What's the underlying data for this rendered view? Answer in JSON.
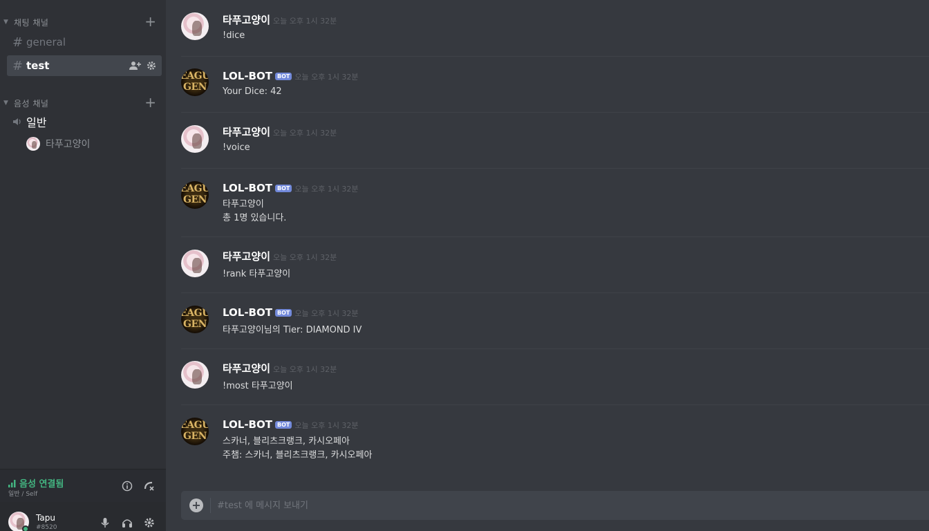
{
  "sidebar": {
    "text_category": "채팅 채널",
    "voice_category": "음성 채널",
    "text_channels": [
      {
        "name": "general",
        "active": false
      },
      {
        "name": "test",
        "active": true
      }
    ],
    "voice_channel": "일반",
    "voice_users": [
      "타푸고양이"
    ]
  },
  "voice_panel": {
    "status": "음성 연결됨",
    "sub": "일반 / Self"
  },
  "user_panel": {
    "username": "Tapu",
    "tag": "#8520"
  },
  "messages": [
    {
      "author": "타푸고양이",
      "bot": false,
      "time": "오늘 오후 1시 32분",
      "lines": [
        "!dice"
      ]
    },
    {
      "author": "LOL-BOT",
      "bot": true,
      "badge": "BOT",
      "time": "오늘 오후 1시 32분",
      "lines": [
        "Your Dice: 42"
      ]
    },
    {
      "author": "타푸고양이",
      "bot": false,
      "time": "오늘 오후 1시 32분",
      "lines": [
        "!voice"
      ]
    },
    {
      "author": "LOL-BOT",
      "bot": true,
      "badge": "BOT",
      "time": "오늘 오후 1시 32분",
      "lines": [
        "타푸고양이",
        "총 1명 있습니다."
      ]
    },
    {
      "author": "타푸고양이",
      "bot": false,
      "time": "오늘 오후 1시 32분",
      "lines": [
        "!rank 타푸고양이"
      ]
    },
    {
      "author": "LOL-BOT",
      "bot": true,
      "badge": "BOT",
      "time": "오늘 오후 1시 32분",
      "lines": [
        "타푸고양이님의 Tier: DIAMOND IV"
      ]
    },
    {
      "author": "타푸고양이",
      "bot": false,
      "time": "오늘 오후 1시 32분",
      "lines": [
        "!most 타푸고양이"
      ]
    },
    {
      "author": "LOL-BOT",
      "bot": true,
      "badge": "BOT",
      "time": "오늘 오후 1시 32분",
      "lines": [
        "스카너, 블리츠크랭크, 카시오페아",
        "주챔: 스카너, 블리츠크랭크, 카시오페아"
      ]
    }
  ],
  "bot_avatar_text": [
    "EAGU",
    "GEN"
  ],
  "composer": {
    "placeholder": "#test 에 메시지 보내기"
  }
}
